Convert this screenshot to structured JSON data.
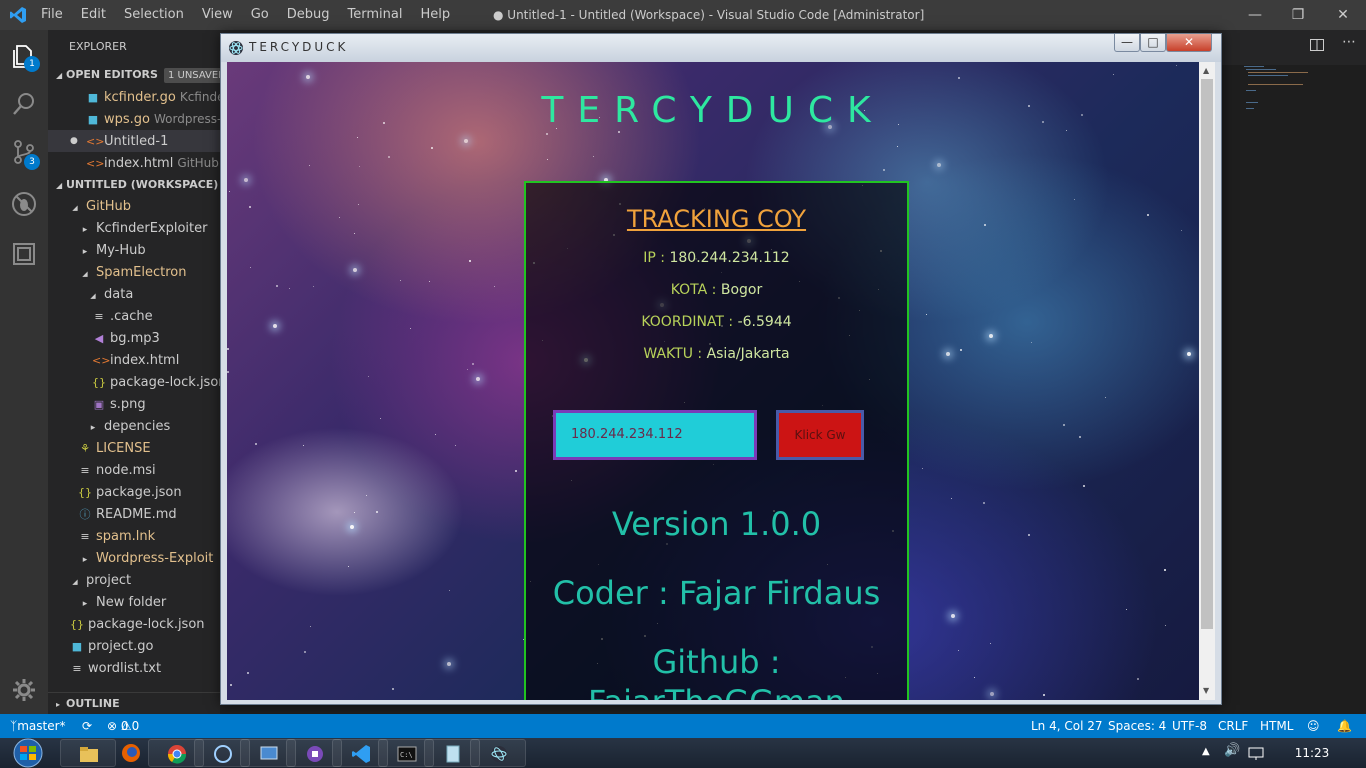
{
  "titlebar": {
    "menu": [
      "File",
      "Edit",
      "Selection",
      "View",
      "Go",
      "Debug",
      "Terminal",
      "Help"
    ],
    "title": "● Untitled-1 - Untitled (Workspace) - Visual Studio Code [Administrator]"
  },
  "activity": {
    "explorer_badge": "1",
    "scm_badge": "3"
  },
  "sidebar": {
    "header": "EXPLORER",
    "open_editors": {
      "label": "OPEN EDITORS",
      "unsaved": "1 UNSAVED",
      "items": [
        {
          "name": "kcfinder.go",
          "desc": "Kcfinder",
          "icon": "go-file-icon",
          "color": "#e2c08d"
        },
        {
          "name": "wps.go",
          "desc": "Wordpress-E",
          "icon": "go-file-icon",
          "color": "#e2c08d"
        },
        {
          "name": "Untitled-1",
          "desc": "",
          "icon": "html-file-icon",
          "color": "#cccccc"
        },
        {
          "name": "index.html",
          "desc": "GitHub •",
          "icon": "html-file-icon",
          "color": "#cccccc"
        }
      ]
    },
    "workspace": {
      "label": "UNTITLED (WORKSPACE)",
      "items": [
        {
          "name": "GitHub",
          "color": "#e2c08d"
        },
        {
          "name": "KcfinderExploiter",
          "color": "#cccccc"
        },
        {
          "name": "My-Hub",
          "color": "#cccccc"
        },
        {
          "name": "SpamElectron",
          "color": "#e2c08d"
        },
        {
          "name": "data",
          "color": "#cccccc"
        },
        {
          "name": ".cache",
          "color": "#cccccc"
        },
        {
          "name": "bg.mp3",
          "color": "#cccccc"
        },
        {
          "name": "index.html",
          "color": "#cccccc"
        },
        {
          "name": "package-lock.json",
          "color": "#cccccc"
        },
        {
          "name": "s.png",
          "color": "#cccccc"
        },
        {
          "name": "depencies",
          "color": "#cccccc"
        },
        {
          "name": "LICENSE",
          "color": "#e2c08d"
        },
        {
          "name": "node.msi",
          "color": "#cccccc"
        },
        {
          "name": "package.json",
          "color": "#cccccc"
        },
        {
          "name": "README.md",
          "color": "#cccccc"
        },
        {
          "name": "spam.lnk",
          "color": "#e2c08d"
        },
        {
          "name": "Wordpress-Exploit",
          "color": "#e2c08d"
        },
        {
          "name": "project",
          "color": "#cccccc"
        },
        {
          "name": "New folder",
          "color": "#cccccc"
        },
        {
          "name": "package-lock.json",
          "color": "#cccccc"
        },
        {
          "name": "project.go",
          "color": "#cccccc"
        },
        {
          "name": "wordlist.txt",
          "color": "#cccccc"
        }
      ]
    },
    "outline_label": "OUTLINE"
  },
  "statusbar": {
    "branch": "master*",
    "errors": "0",
    "warnings": "0",
    "position": "Ln 4, Col 27",
    "spaces": "Spaces: 4",
    "encoding": "UTF-8",
    "eol": "CRLF",
    "language": "HTML"
  },
  "taskbar": {
    "clock": "11:23"
  },
  "app": {
    "window_title": "TERCYDUCK",
    "heading": "TERCYDUCK",
    "panel_title": "TRACKING COY",
    "ip_label": "IP :",
    "ip_value": "180.244.234.112",
    "kota_label": "KOTA :",
    "kota_value": "Bogor",
    "koordinat_label": "KOORDINAT :",
    "koordinat_value": "-6.5944",
    "waktu_label": "WAKTU :",
    "waktu_value": "Asia/Jakarta",
    "input_value": "180.244.234.112",
    "button_label": "Klick Gw",
    "version": "Version 1.0.0",
    "coder": "Coder : Fajar Firdaus",
    "github_line1": "Github :",
    "github_line2": "FajarTheGGman"
  },
  "colors": {
    "statusbar": "#007acc",
    "accent_green": "#2ee8a0",
    "panel_border": "#21c421",
    "panel_title": "#f0a23c"
  }
}
